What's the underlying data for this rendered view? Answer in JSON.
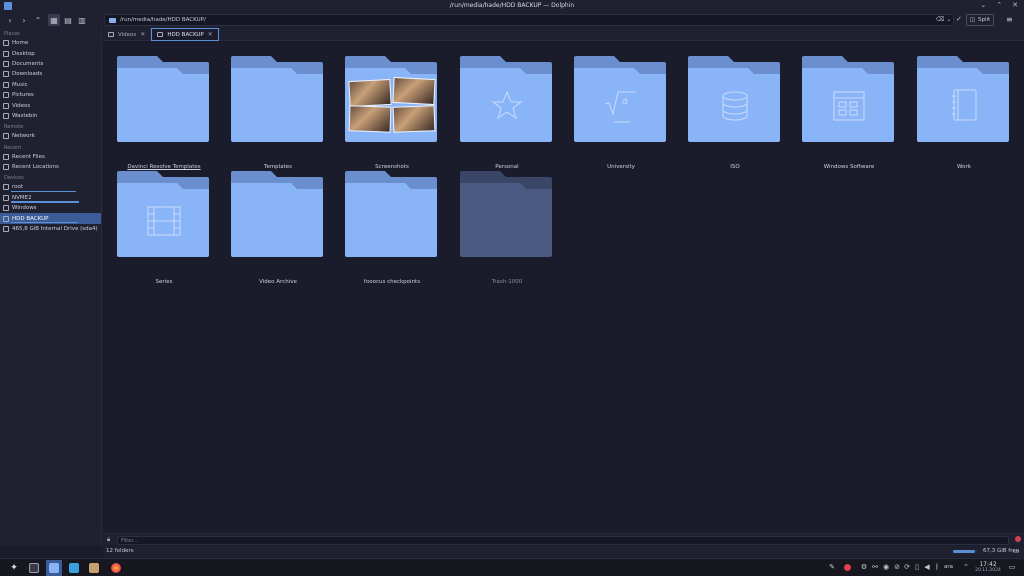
{
  "window": {
    "title": "/run/media/hade/HDD BACKUP — Dolphin"
  },
  "toolbar": {
    "location_path": "/run/media/hade/HDD BACKUP/",
    "split_label": "Split"
  },
  "sidebar": {
    "sections": [
      {
        "label": "Places",
        "items": [
          {
            "label": "Home",
            "icon": "home-icon"
          },
          {
            "label": "Desktop",
            "icon": "desktop-icon"
          },
          {
            "label": "Documents",
            "icon": "documents-icon"
          },
          {
            "label": "Downloads",
            "icon": "downloads-icon"
          },
          {
            "label": "Music",
            "icon": "music-icon"
          },
          {
            "label": "Pictures",
            "icon": "pictures-icon"
          },
          {
            "label": "Videos",
            "icon": "videos-icon"
          },
          {
            "label": "Wastebin",
            "icon": "trash-icon"
          }
        ]
      },
      {
        "label": "Remote",
        "items": [
          {
            "label": "Network",
            "icon": "network-icon"
          }
        ]
      },
      {
        "label": "Recent",
        "items": [
          {
            "label": "Recent Files",
            "icon": "recent-files-icon"
          },
          {
            "label": "Recent Locations",
            "icon": "recent-locations-icon"
          }
        ]
      },
      {
        "label": "Devices",
        "items": [
          {
            "label": "root",
            "icon": "drive-icon",
            "usage": 0.85
          },
          {
            "label": "NVME2",
            "icon": "drive-icon",
            "usage": 0.9
          },
          {
            "label": "Windows",
            "icon": "drive-icon"
          },
          {
            "label": "HDD BACKUP",
            "icon": "drive-icon",
            "usage": 0.88,
            "selected": true
          },
          {
            "label": "465,8 GiB Internal Drive (sda4)",
            "icon": "drive-icon"
          }
        ]
      }
    ]
  },
  "tabs": [
    {
      "label": "Videos",
      "active": false
    },
    {
      "label": "HDD BACKUP",
      "active": true
    }
  ],
  "folders": [
    {
      "name": "Davinci Resolve Templates",
      "emblem": "none"
    },
    {
      "name": "Templates",
      "emblem": "none"
    },
    {
      "name": "Screenshots",
      "emblem": "thumbnails"
    },
    {
      "name": "Personal",
      "emblem": "star-icon"
    },
    {
      "name": "University",
      "emblem": "sqrt-icon"
    },
    {
      "name": "ISO",
      "emblem": "database-icon"
    },
    {
      "name": "Windows Software",
      "emblem": "window-icon"
    },
    {
      "name": "Work",
      "emblem": "notebook-icon"
    },
    {
      "name": "Series",
      "emblem": "film-icon"
    },
    {
      "name": "Video Archive",
      "emblem": "none"
    },
    {
      "name": "fooocus checkpoints",
      "emblem": "none"
    },
    {
      "name": "Trash-1000",
      "emblem": "none",
      "dim": true
    }
  ],
  "filter": {
    "placeholder": "Filter..."
  },
  "status": {
    "folder_count": "12 folders",
    "free_space": "67,3 GiB free",
    "disk_usage": 0.9
  },
  "taskbar": {
    "keyboard_layout": "ara",
    "time": "17:42",
    "date": "20.11.2024"
  },
  "colors": {
    "folder_front": "#8ab4f8",
    "folder_back": "#6b8ecf",
    "folder_dim_front": "#4a5a82",
    "folder_dim_back": "#3a4666",
    "accent": "#3b5c96"
  }
}
